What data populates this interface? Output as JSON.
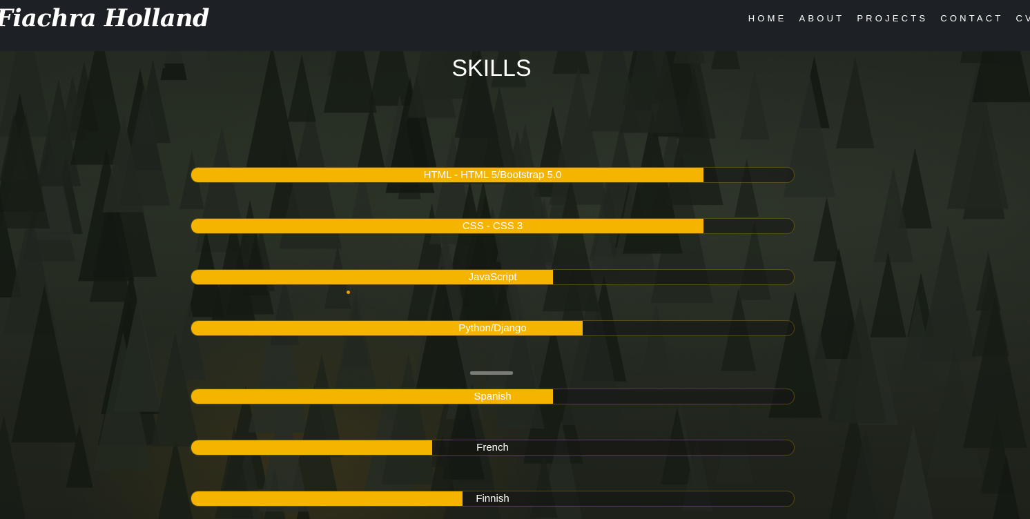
{
  "brand": "Fiachra Holland",
  "nav": [
    {
      "label": "HOME"
    },
    {
      "label": "ABOUT"
    },
    {
      "label": "PROJECTS"
    },
    {
      "label": "CONTACT"
    },
    {
      "label": "CV"
    }
  ],
  "section_title": "SKILLS",
  "accent_color": "#f4b400",
  "skills": [
    {
      "label": "HTML - HTML 5/Bootstrap 5.0",
      "level": 0.85
    },
    {
      "label": "CSS - CSS 3",
      "level": 0.85
    },
    {
      "label": "JavaScript",
      "level": 0.6
    },
    {
      "label": "Python/Django",
      "level": 0.65
    },
    {
      "label": "Spanish",
      "level": 0.6
    },
    {
      "label": "French",
      "level": 0.4
    },
    {
      "label": "Finnish",
      "level": 0.45
    }
  ]
}
